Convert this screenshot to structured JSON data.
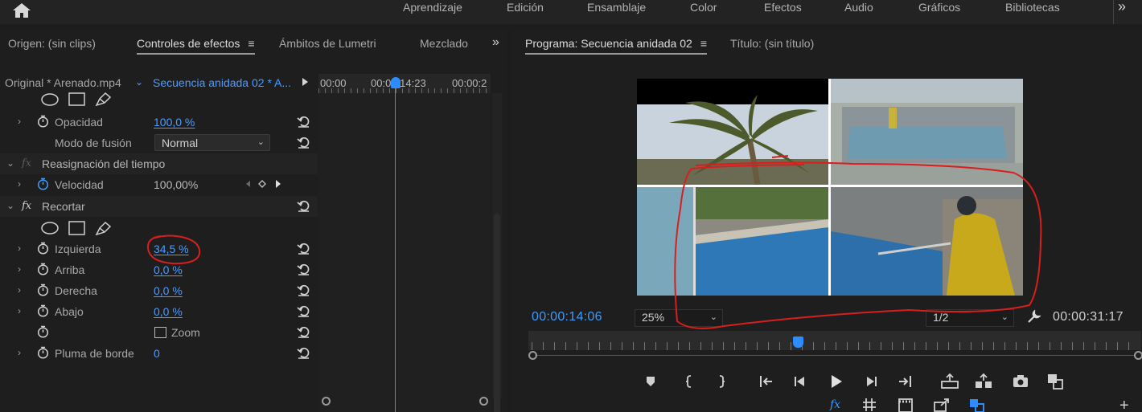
{
  "workspaces": {
    "items": [
      "Aprendizaje",
      "Edición",
      "Ensamblaje",
      "Color",
      "Efectos",
      "Audio",
      "Gráficos",
      "Bibliotecas"
    ],
    "more": "»"
  },
  "left_panel": {
    "tabs": [
      "Origen: (sin clips)",
      "Controles de efectos",
      "Ámbitos de Lumetri",
      "Mezclado"
    ],
    "menu_glyph": "≡",
    "more": "»",
    "source_clip": "Original * Arenado.mp4",
    "sequence_clip": "Secuencia anidada 02 * A...",
    "mini_ruler": [
      "00:00",
      "00:00:14:23",
      "00:00:2"
    ]
  },
  "effects": {
    "opacity": {
      "label": "Opacidad",
      "value": "100,0 %"
    },
    "blend_mode": {
      "label": "Modo de fusión",
      "value": "Normal"
    },
    "time_remap": {
      "label": "Reasignación del tiempo"
    },
    "speed": {
      "label": "Velocidad",
      "value": "100,00%"
    },
    "crop": {
      "label": "Recortar"
    },
    "left": {
      "label": "Izquierda",
      "value": "34,5 %"
    },
    "top": {
      "label": "Arriba",
      "value": "0,0 %"
    },
    "right": {
      "label": "Derecha",
      "value": "0,0 %"
    },
    "bottom": {
      "label": "Abajo",
      "value": "0,0 %"
    },
    "zoom": {
      "label": "Zoom"
    },
    "feather": {
      "label": "Pluma de borde",
      "value": "0"
    },
    "fx_glyph": "fx"
  },
  "program": {
    "tabs": [
      "Programa: Secuencia anidada 02",
      "Título: (sin título)"
    ],
    "menu_glyph": "≡",
    "timecode_current": "00:00:14:06",
    "timecode_duration": "00:00:31:17",
    "zoom_level": "25%",
    "resolution": "1/2",
    "playhead_fraction": 0.44
  },
  "colors": {
    "accent_blue": "#2f8cff",
    "annotation_red": "#d81e1e",
    "panel_bg": "#1e1e1e"
  }
}
